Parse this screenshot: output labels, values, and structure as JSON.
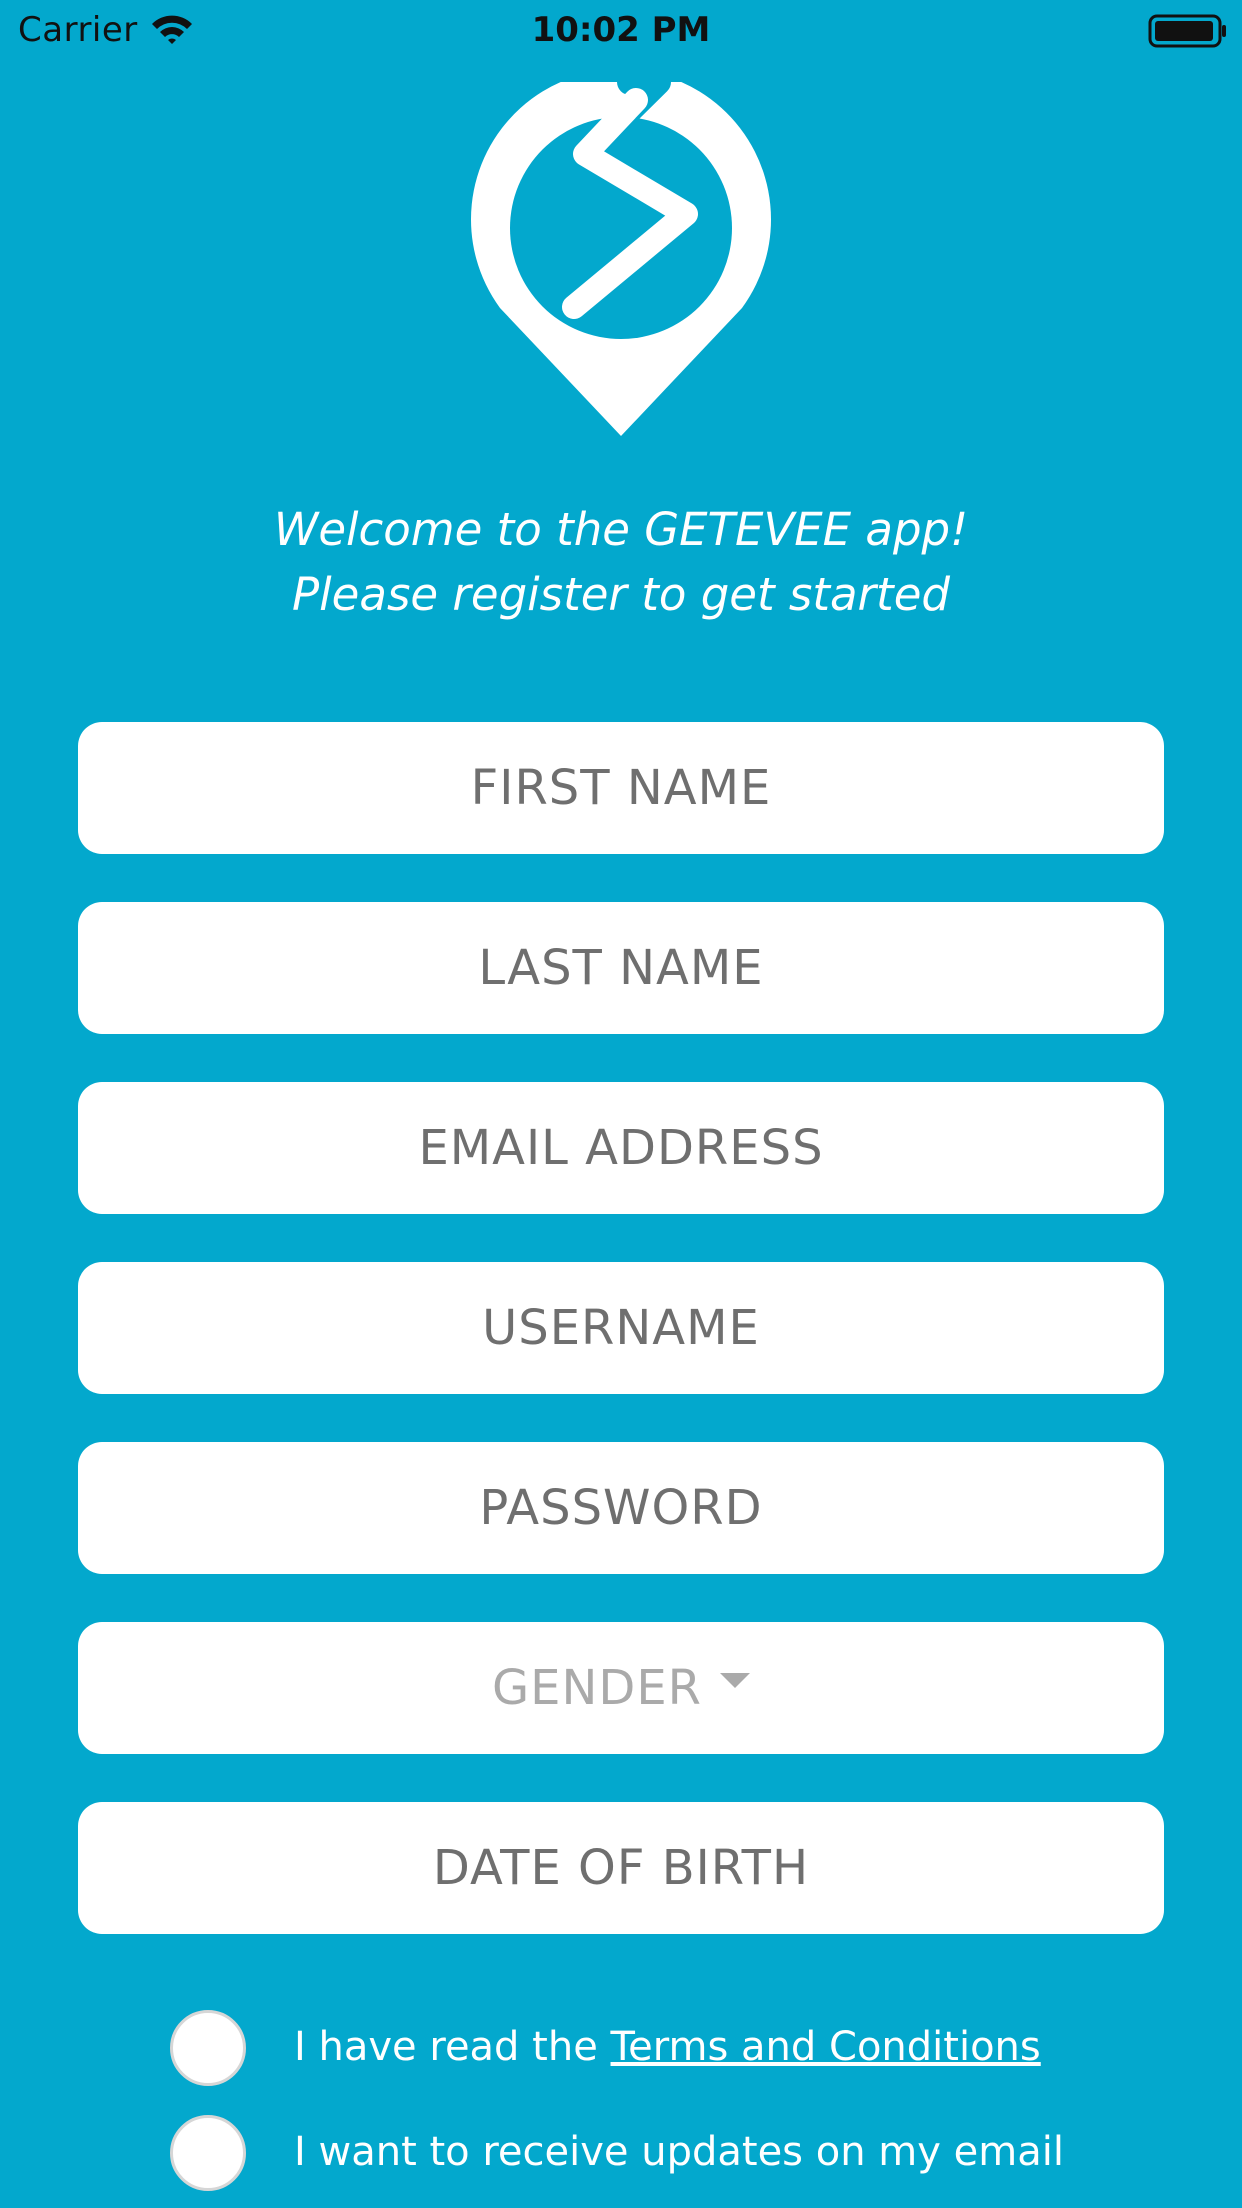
{
  "status_bar": {
    "carrier": "Carrier",
    "time": "10:02 PM",
    "wifi_icon": "wifi-icon",
    "battery_icon": "battery-icon"
  },
  "logo": {
    "icon": "lightning-location-pin-icon"
  },
  "welcome": {
    "line1": "Welcome to the GETEVEE app!",
    "line2": "Please register to get started"
  },
  "form": {
    "first_name": {
      "placeholder": "FIRST NAME",
      "value": ""
    },
    "last_name": {
      "placeholder": "LAST NAME",
      "value": ""
    },
    "email": {
      "placeholder": "EMAIL ADDRESS",
      "value": ""
    },
    "username": {
      "placeholder": "USERNAME",
      "value": ""
    },
    "password": {
      "placeholder": "PASSWORD",
      "value": ""
    },
    "gender": {
      "placeholder": "GENDER",
      "value": ""
    },
    "date_of_birth": {
      "placeholder": "DATE OF BIRTH",
      "value": ""
    }
  },
  "agreements": {
    "terms_prefix": "I have read the ",
    "terms_link": "Terms and Conditions",
    "terms_checked": false,
    "updates_label": "I want to receive updates on my email",
    "updates_checked": false
  },
  "colors": {
    "background": "#03A8CD",
    "field_background": "#FFFFFF",
    "placeholder_text": "#6F6F6F",
    "welcome_text": "#FFFFFF"
  }
}
